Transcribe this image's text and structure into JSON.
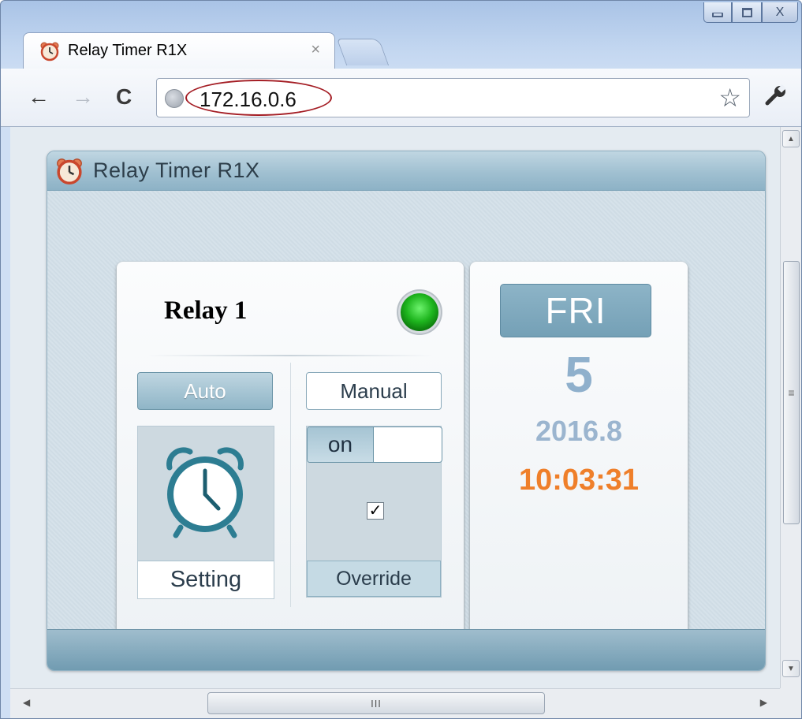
{
  "browser": {
    "tab_title": "Relay Timer R1X",
    "tab_close": "×",
    "url": "172.16.0.6",
    "nav": {
      "back": "←",
      "forward": "→",
      "reload": "C"
    },
    "star": "☆",
    "window_close": "X",
    "scroll_grip_vertical": "≡",
    "scroll_grip_horizontal": "III",
    "icons": [
      "alarm-clock-icon",
      "globe-icon",
      "star-icon",
      "wrench-icon"
    ],
    "annotation_color": "#a41d24"
  },
  "app": {
    "title": "Relay Timer R1X",
    "relay": {
      "name": "Relay 1",
      "status_color": "#1eb51e",
      "auto_label": "Auto",
      "manual_label": "Manual",
      "setting_label": "Setting",
      "toggle_label": "on",
      "override_checked": "✓",
      "override_label": "Override"
    },
    "date": {
      "day": "FRI",
      "day_number": "5",
      "year_month": "2016.8",
      "time": "10:03:31",
      "time_color": "#ef7f2a"
    }
  }
}
